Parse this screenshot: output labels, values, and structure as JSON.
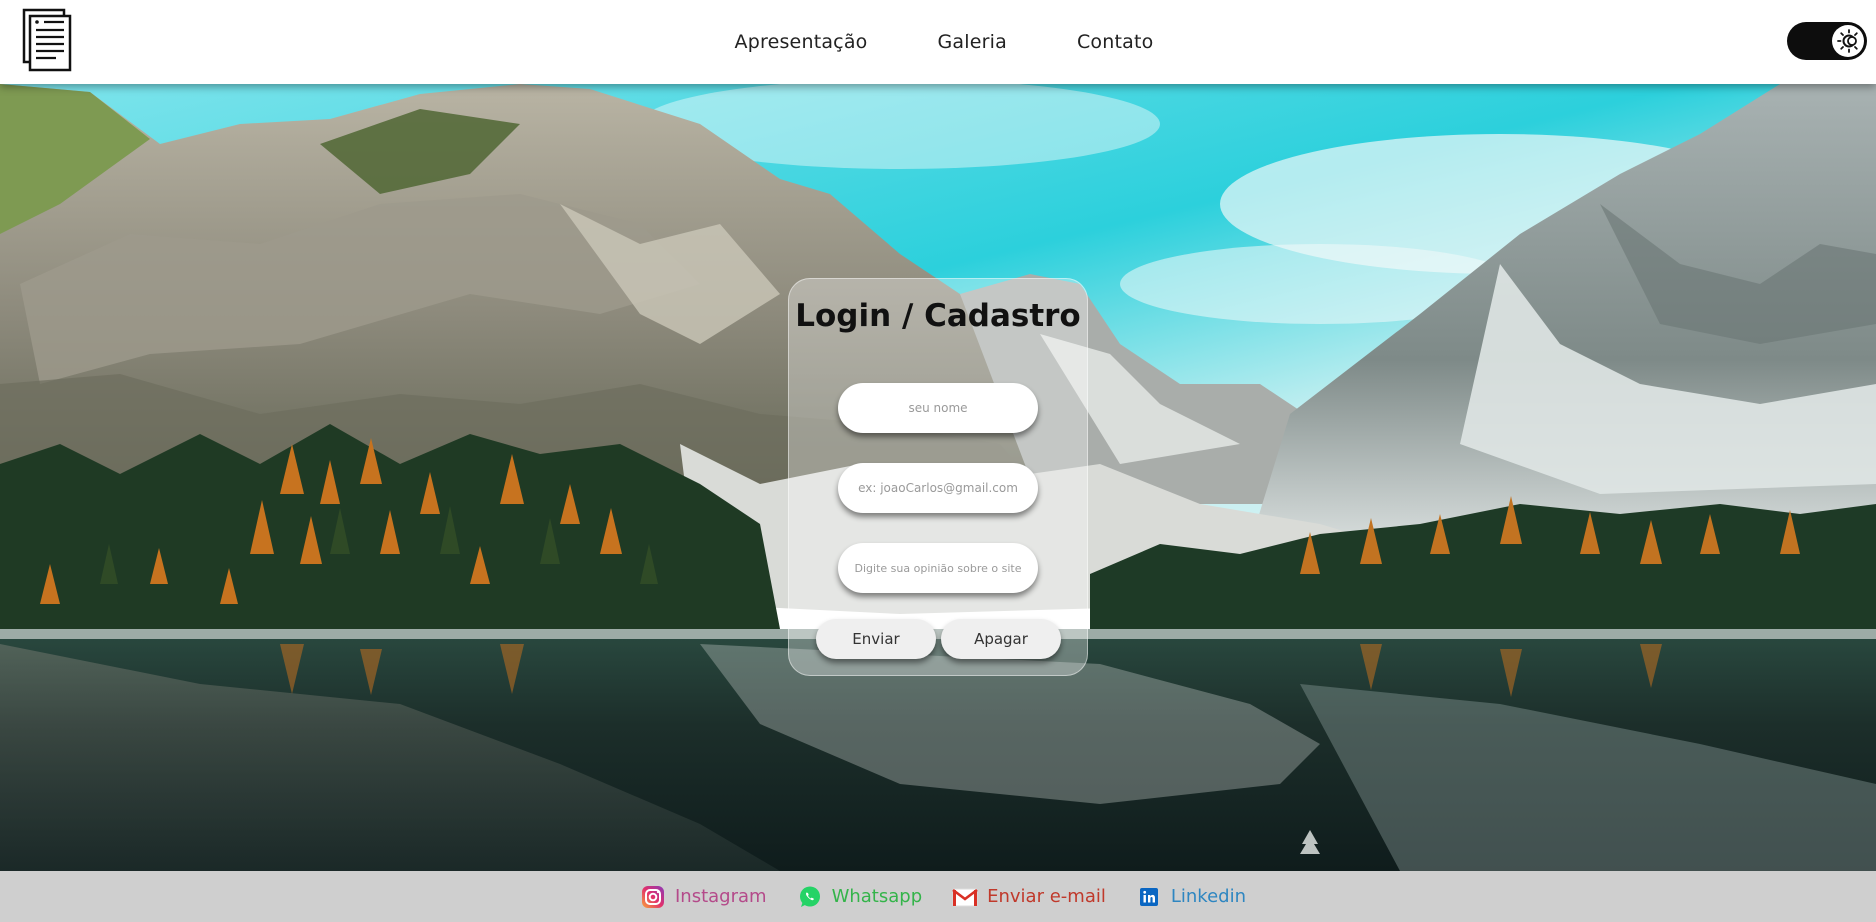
{
  "header": {
    "logo_icon": "document-icon",
    "nav": [
      {
        "label": "Apresentação"
      },
      {
        "label": "Galeria"
      },
      {
        "label": "Contato"
      }
    ],
    "theme_toggle": {
      "icon": "sun-icon",
      "state": "dark"
    }
  },
  "hero": {
    "background": "mountain-lake-landscape"
  },
  "login": {
    "title": "Login / Cadastro",
    "name_placeholder": "seu nome",
    "email_placeholder": "ex: joaoCarlos@gmail.com",
    "opinion_placeholder": "Digite sua opinião sobre o site",
    "send_label": "Enviar",
    "clear_label": "Apagar"
  },
  "footer": {
    "links": [
      {
        "label": "Instagram",
        "icon": "instagram-icon",
        "color": "#b44a8a"
      },
      {
        "label": "Whatsapp",
        "icon": "whatsapp-icon",
        "color": "#34b44a"
      },
      {
        "label": "Enviar e-mail",
        "icon": "gmail-icon",
        "color": "#c0392b"
      },
      {
        "label": "Linkedin",
        "icon": "linkedin-icon",
        "color": "#2e86c1"
      }
    ]
  },
  "colors": {
    "header_bg": "#ffffff",
    "footer_bg": "#cfcfcf",
    "toggle_bg": "#0d0d0d",
    "sky": "#3fd2dc"
  }
}
